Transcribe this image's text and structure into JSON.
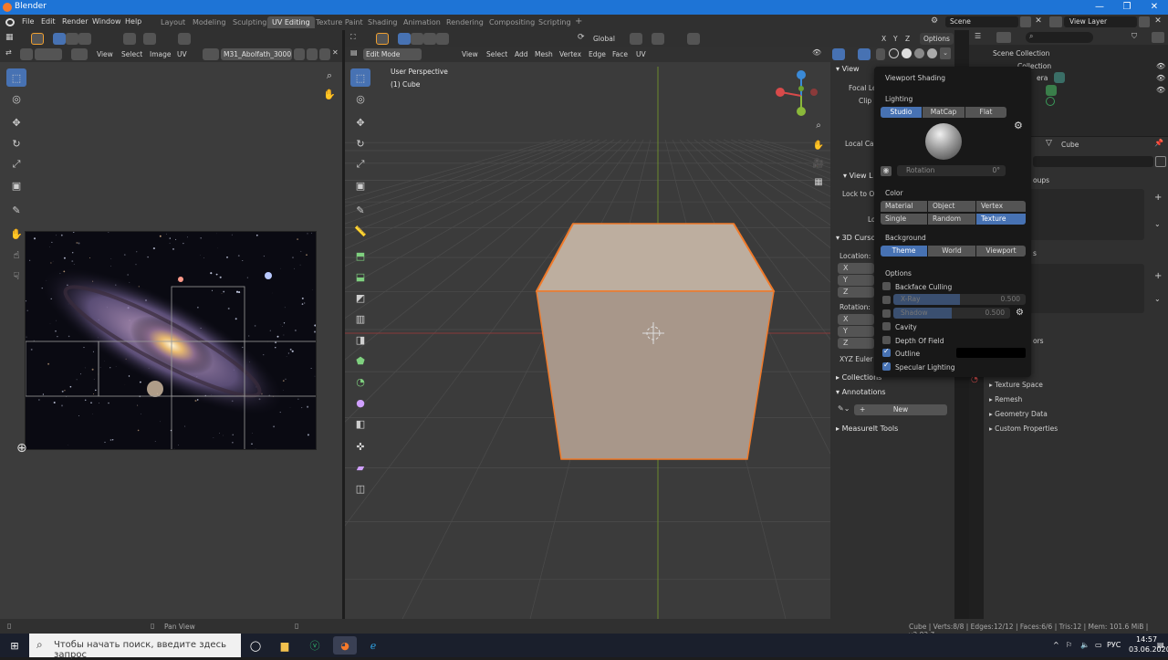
{
  "window": {
    "title": "Blender"
  },
  "menu": {
    "items": [
      "File",
      "Edit",
      "Render",
      "Window",
      "Help"
    ]
  },
  "workspaces": {
    "tabs": [
      "Layout",
      "Modeling",
      "Sculpting",
      "UV Editing",
      "Texture Paint",
      "Shading",
      "Animation",
      "Rendering",
      "Compositing",
      "Scripting"
    ],
    "active": "UV Editing",
    "add_label": "+"
  },
  "scene": {
    "label": "Scene",
    "view_layer": "View Layer"
  },
  "uv_editor": {
    "menus": [
      "View",
      "Select",
      "Image",
      "UV"
    ],
    "image_name": "M31_Abolfath_3000..."
  },
  "viewport": {
    "mode": "Edit Mode",
    "menus": [
      "View",
      "Select",
      "Add",
      "Mesh",
      "Vertex",
      "Edge",
      "Face",
      "UV"
    ],
    "orientation": "Global",
    "options_label": "Options",
    "axis_labels": [
      "X",
      "Y",
      "Z"
    ],
    "overlay_line1": "User Perspective",
    "overlay_line2": "(1) Cube"
  },
  "npanel": {
    "view_head": "View",
    "focal": "Focal Le",
    "clip": "Clip S",
    "local_cam": "Local Ca",
    "view_lock": "View L",
    "lock_to_obj": "Lock to Ob",
    "lo": "Lo",
    "cursor_head": "3D Cursor",
    "location": "Location:",
    "x": "X",
    "y": "Y",
    "z": "Z",
    "rotation": "Rotation:",
    "euler": "XYZ Euler",
    "collections": "Collections",
    "annotations": "Annotations",
    "new_label": "New",
    "measureit": "MeasureIt Tools"
  },
  "shading": {
    "title": "Viewport Shading",
    "lighting_label": "Lighting",
    "lighting_opts": [
      "Studio",
      "MatCap",
      "Flat"
    ],
    "lighting_active": "Studio",
    "rotation_label": "Rotation",
    "rotation_value": "0°",
    "color_label": "Color",
    "color_opts": [
      "Material",
      "Object",
      "Vertex",
      "Single",
      "Random",
      "Texture"
    ],
    "color_active": "Texture",
    "background_label": "Background",
    "bg_opts": [
      "Theme",
      "World",
      "Viewport"
    ],
    "bg_active": "Theme",
    "options_label": "Options",
    "backface": "Backface Culling",
    "xray": "X-Ray",
    "xray_value": "0.500",
    "shadow": "Shadow",
    "shadow_value": "0.500",
    "cavity": "Cavity",
    "dof": "Depth Of Field",
    "outline": "Outline",
    "specular": "Specular Lighting"
  },
  "outliner": {
    "scene_collection": "Scene Collection",
    "collection": "Collection",
    "camera": "era"
  },
  "properties": {
    "object_name": "Cube",
    "groups": "oups",
    "s_label": "s",
    "ors": "ors",
    "items": [
      "Texture Space",
      "Remesh",
      "Geometry Data",
      "Custom Properties"
    ]
  },
  "status": {
    "pan": "Pan View",
    "stats": "Cube | Verts:8/8 | Edges:12/12 | Faces:6/6 | Tris:12 | Mem: 101.6 MiB | v2.82.7"
  },
  "taskbar": {
    "search_placeholder": "Чтобы начать поиск, введите здесь запрос",
    "lang": "РУС",
    "time": "14:57",
    "date": "03.06.2020"
  },
  "colors": {
    "accent": "#4772b3",
    "outline": "#f07a2a",
    "cube_face": "#b3a293"
  }
}
